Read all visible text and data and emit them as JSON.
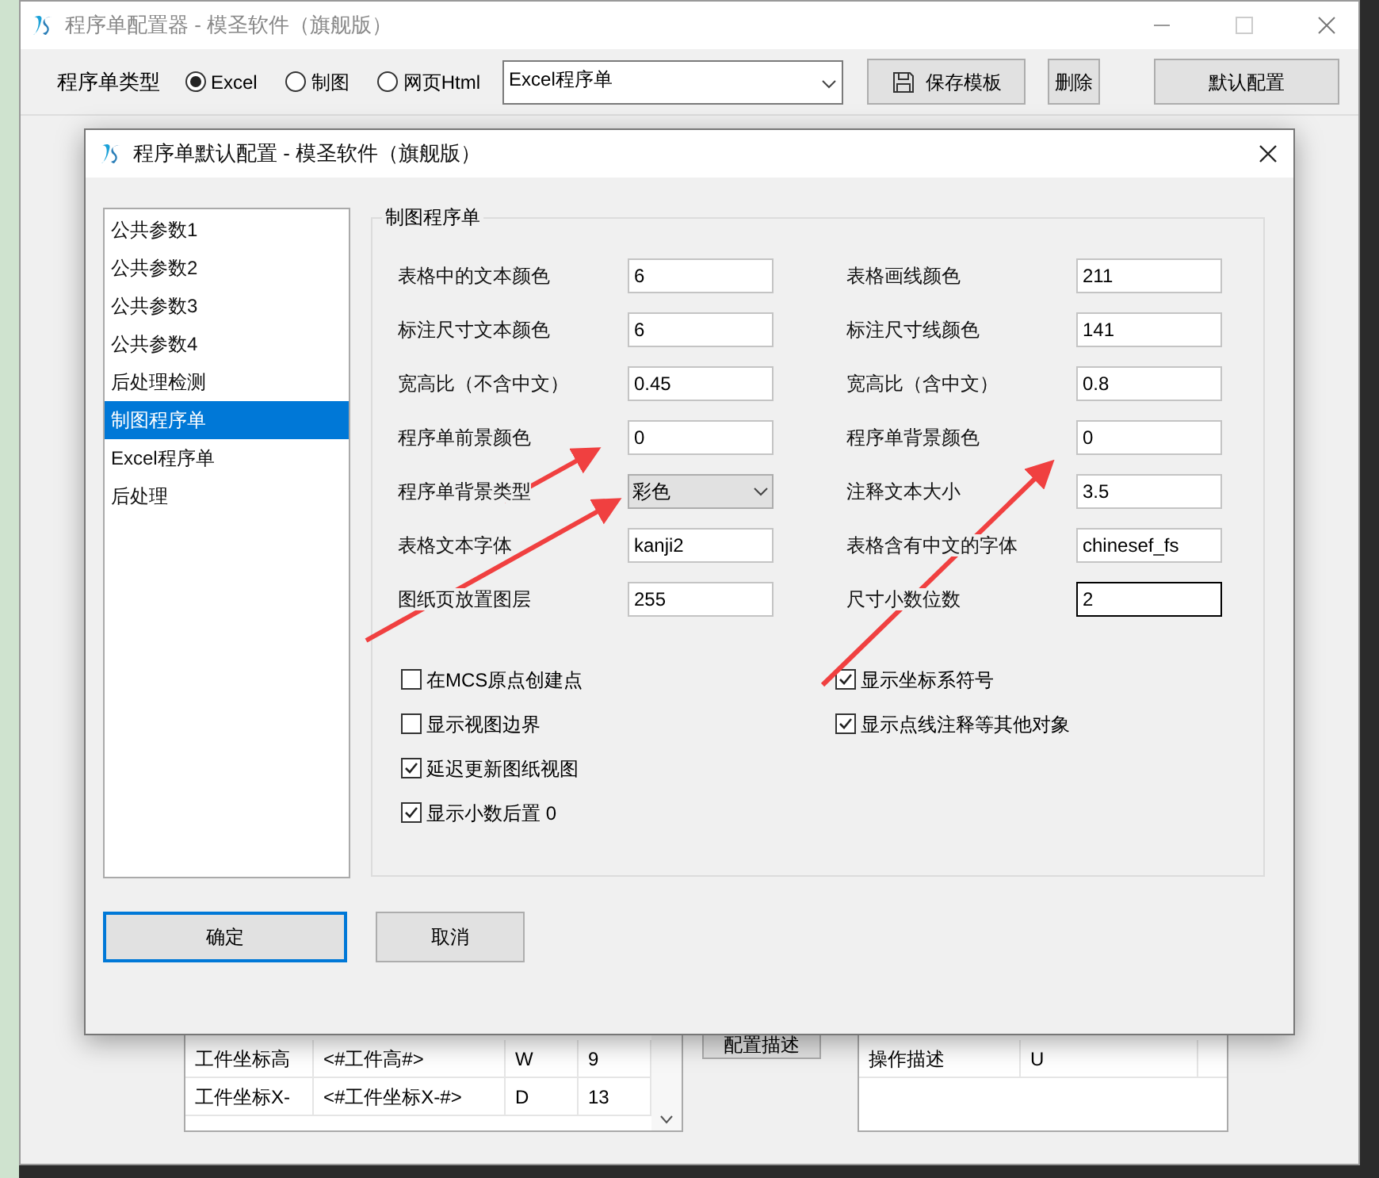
{
  "main_window": {
    "title": "程序单配置器 - 模圣软件（旗舰版）",
    "type_label": "程序单类型",
    "type_options": [
      {
        "label": "Excel",
        "selected": true
      },
      {
        "label": "制图",
        "selected": false
      },
      {
        "label": "网页Html",
        "selected": false
      }
    ],
    "template_select": "Excel程序单",
    "buttons": [
      {
        "kind": "save",
        "label": "保存模板"
      },
      {
        "kind": "plain",
        "label": "删除"
      },
      {
        "kind": "wide",
        "label": "默认配置"
      }
    ],
    "left_table": {
      "rows": [
        [
          "工件坐标高",
          "<#工件高#>",
          "W",
          "9"
        ],
        [
          "工件坐标X-",
          "<#工件坐标X-#>",
          "D",
          "13"
        ]
      ]
    },
    "middle_button": "配置描述",
    "right_table": {
      "rows": [
        [
          "操作描述",
          "U"
        ]
      ]
    }
  },
  "dialog": {
    "title": "程序单默认配置 - 模圣软件（旗舰版）",
    "nav_items": [
      {
        "label": "公共参数1",
        "selected": false
      },
      {
        "label": "公共参数2",
        "selected": false
      },
      {
        "label": "公共参数3",
        "selected": false
      },
      {
        "label": "公共参数4",
        "selected": false
      },
      {
        "label": "后处理检测",
        "selected": false
      },
      {
        "label": "制图程序单",
        "selected": true
      },
      {
        "label": "Excel程序单",
        "selected": false
      },
      {
        "label": "后处理",
        "selected": false
      }
    ],
    "group_title": "制图程序单",
    "fields": [
      {
        "label": "表格中的文本颜色",
        "value": "6",
        "kind": "text",
        "focused": false
      },
      {
        "label": "表格画线颜色",
        "value": "211",
        "kind": "text",
        "focused": false
      },
      {
        "label": "标注尺寸文本颜色",
        "value": "6",
        "kind": "text",
        "focused": false
      },
      {
        "label": "标注尺寸线颜色",
        "value": "141",
        "kind": "text",
        "focused": false
      },
      {
        "label": "宽高比（不含中文）",
        "value": "0.45",
        "kind": "text",
        "focused": false
      },
      {
        "label": "宽高比（含中文）",
        "value": "0.8",
        "kind": "text",
        "focused": false
      },
      {
        "label": "程序单前景颜色",
        "value": "0",
        "kind": "text",
        "focused": false
      },
      {
        "label": "程序单背景颜色",
        "value": "0",
        "kind": "text",
        "focused": false
      },
      {
        "label": "程序单背景类型",
        "value": "彩色",
        "kind": "select"
      },
      {
        "label": "注释文本大小",
        "value": "3.5",
        "kind": "text",
        "focused": false
      },
      {
        "label": "表格文本字体",
        "value": "kanji2",
        "kind": "text",
        "focused": false
      },
      {
        "label": "表格含有中文的字体",
        "value": "chinesef_fs",
        "kind": "text",
        "focused": false
      },
      {
        "label": "图纸页放置图层",
        "value": "255",
        "kind": "text",
        "focused": false
      },
      {
        "label": "尺寸小数位数",
        "value": "2",
        "kind": "text",
        "focused": true
      }
    ],
    "checkboxes_left": [
      {
        "label": "在MCS原点创建点",
        "checked": false
      },
      {
        "label": "显示视图边界",
        "checked": false
      },
      {
        "label": "延迟更新图纸视图",
        "checked": true
      },
      {
        "label": "显示小数后置 0",
        "checked": true
      }
    ],
    "checkboxes_right": [
      {
        "label": "显示坐标系符号",
        "checked": true
      },
      {
        "label": "显示点线注释等其他对象",
        "checked": true
      }
    ],
    "buttons": [
      {
        "label": "确定",
        "default": true
      },
      {
        "label": "取消",
        "default": false
      }
    ]
  }
}
